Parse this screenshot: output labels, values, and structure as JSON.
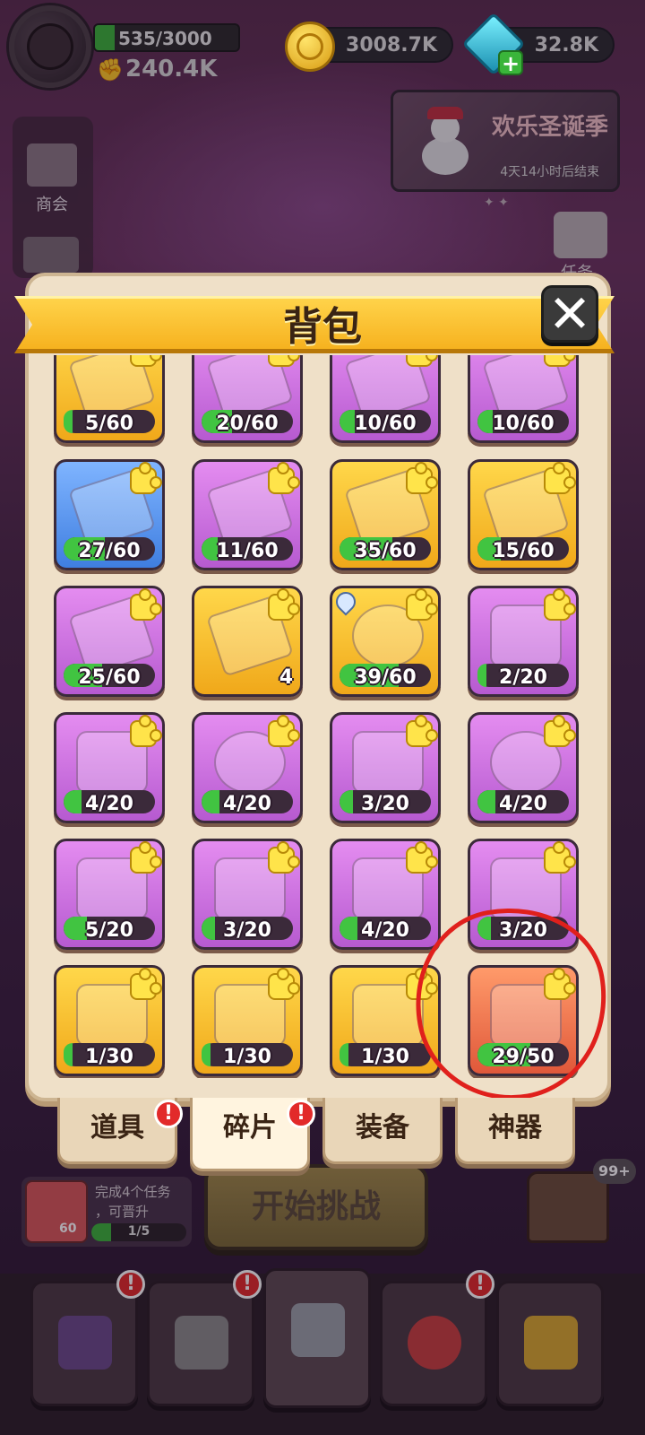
{
  "hud": {
    "energy": "535/3000",
    "power": "240.4K",
    "coins": "3008.7K",
    "gems": "32.8K",
    "gem_plus": "+"
  },
  "event": {
    "title": "欢乐圣诞季",
    "countdown": "4天14小时后结束"
  },
  "side": {
    "shop_label": "商会",
    "task_label": "任务"
  },
  "panel": {
    "title": "背包",
    "close": "✕"
  },
  "items": [
    {
      "color": "gold",
      "art": "piece",
      "text": "5/60",
      "progress": 0.083
    },
    {
      "color": "purple",
      "art": "piece",
      "text": "20/60",
      "progress": 0.333
    },
    {
      "color": "purple",
      "art": "piece",
      "text": "10/60",
      "progress": 0.167
    },
    {
      "color": "purple",
      "art": "piece",
      "text": "10/60",
      "progress": 0.167
    },
    {
      "color": "blue",
      "art": "piece",
      "text": "27/60",
      "progress": 0.45
    },
    {
      "color": "purple",
      "art": "piece",
      "text": "11/60",
      "progress": 0.183
    },
    {
      "color": "gold",
      "art": "piece",
      "text": "35/60",
      "progress": 0.583
    },
    {
      "color": "gold",
      "art": "piece",
      "text": "15/60",
      "progress": 0.25
    },
    {
      "color": "purple",
      "art": "piece",
      "text": "25/60",
      "progress": 0.417
    },
    {
      "color": "gold",
      "art": "piece",
      "count": "4"
    },
    {
      "color": "gold",
      "art": "monster",
      "text": "39/60",
      "progress": 0.65,
      "drop": true
    },
    {
      "color": "purple",
      "art": "necklace",
      "text": "2/20",
      "progress": 0.1
    },
    {
      "color": "purple",
      "art": "boot",
      "text": "4/20",
      "progress": 0.2
    },
    {
      "color": "purple",
      "art": "ring",
      "text": "4/20",
      "progress": 0.2
    },
    {
      "color": "purple",
      "art": "wolf",
      "text": "3/20",
      "progress": 0.15
    },
    {
      "color": "purple",
      "art": "ring",
      "text": "4/20",
      "progress": 0.2
    },
    {
      "color": "purple",
      "art": "leaf",
      "text": "5/20",
      "progress": 0.25
    },
    {
      "color": "purple",
      "art": "gauntlet",
      "text": "3/20",
      "progress": 0.15
    },
    {
      "color": "purple",
      "art": "horns",
      "text": "4/20",
      "progress": 0.2
    },
    {
      "color": "purple",
      "art": "cape",
      "text": "3/20",
      "progress": 0.15
    },
    {
      "color": "gold",
      "art": "carpet",
      "text": "1/30",
      "progress": 0.033
    },
    {
      "color": "gold",
      "art": "feather",
      "text": "1/30",
      "progress": 0.033
    },
    {
      "color": "gold",
      "art": "hammer",
      "text": "1/30",
      "progress": 0.033
    },
    {
      "color": "red",
      "art": "spirit",
      "text": "29/50",
      "progress": 0.58
    }
  ],
  "tabs": [
    {
      "label": "道具",
      "badge": "!"
    },
    {
      "label": "碎片",
      "badge": "!",
      "active": true
    },
    {
      "label": "装备"
    },
    {
      "label": "神器"
    }
  ],
  "task": {
    "line1": "完成4个任务",
    "line2": "，可晋升",
    "progress_text": "1/5",
    "thumb_count": "60"
  },
  "start_button": "开始挑战",
  "chest_badge": "99+",
  "nav": [
    {
      "name": "scroll",
      "badge": "!"
    },
    {
      "name": "helmet",
      "badge": "!"
    },
    {
      "name": "battle"
    },
    {
      "name": "target",
      "badge": "!"
    },
    {
      "name": "trophy"
    }
  ],
  "colors": {
    "panel_bg": "#efe0c8",
    "ribbon": "#f6b21f",
    "progress_green": "#41c441",
    "badge_red": "#e22a2a",
    "annotation_circle": "#e0201c"
  }
}
